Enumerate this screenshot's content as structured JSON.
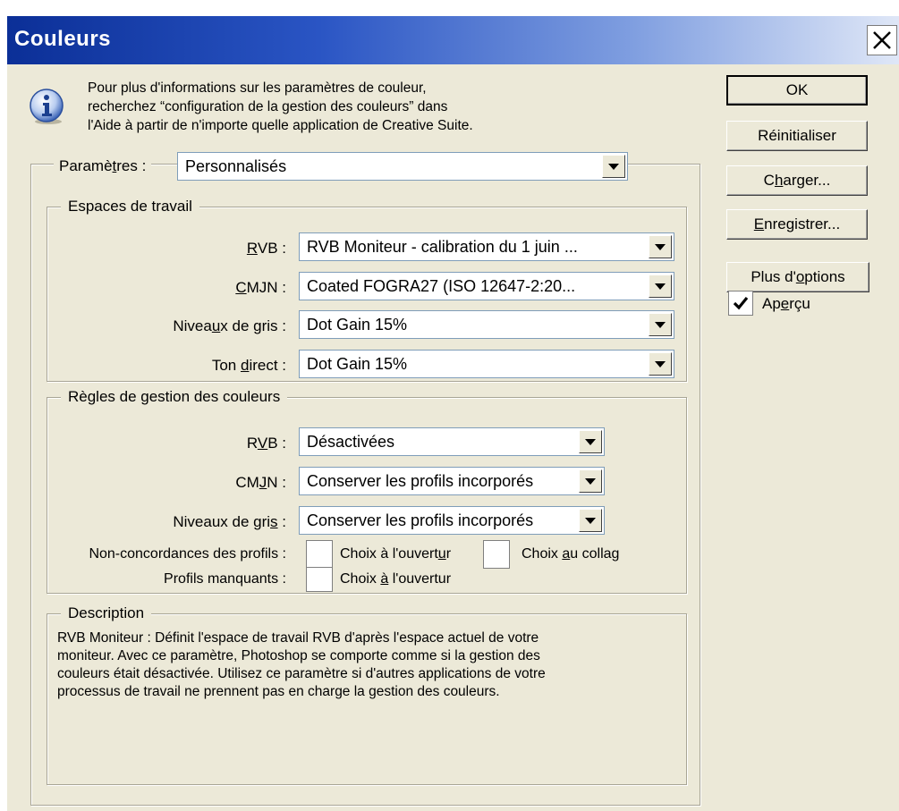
{
  "window": {
    "title": "Couleurs"
  },
  "info": {
    "icon": "info-icon",
    "lines": [
      "Pour plus d'informations sur les paramètres de couleur,",
      "recherchez “configuration de la gestion des couleurs” dans",
      "l'Aide à partir de n'importe quelle application de Creative Suite."
    ]
  },
  "settings": {
    "label": "Paramètres :",
    "value": "Personnalisés"
  },
  "workspaces": {
    "legend": "Espaces de travail",
    "rgb": {
      "label": "RVB :",
      "value": "RVB Moniteur - calibration du 1 juin ..."
    },
    "cmyk": {
      "label": "CMJN :",
      "value": "Coated FOGRA27 (ISO 12647-2:20..."
    },
    "gray": {
      "label": "Niveaux de gris :",
      "value": "Dot Gain 15%"
    },
    "spot": {
      "label": "Ton direct :",
      "value": "Dot Gain 15%"
    }
  },
  "policies": {
    "legend": "Règles de gestion des couleurs",
    "rgb": {
      "label": "RVB :",
      "value": "Désactivées"
    },
    "cmyk": {
      "label": "CMJN :",
      "value": "Conserver les profils incorporés"
    },
    "gray": {
      "label": "Niveaux de gris :",
      "value": "Conserver les profils incorporés"
    },
    "mismatch": {
      "label": "Non-concordances des profils :",
      "open": "Choix à l'ouvertur",
      "paste": "Choix au collag"
    },
    "missing": {
      "label": "Profils manquants :",
      "open": "Choix à l'ouvertur"
    }
  },
  "description": {
    "legend": "Description",
    "lines": [
      "RVB Moniteur : Définit l'espace de travail RVB d'après l'espace actuel de votre",
      "moniteur. Avec ce paramètre, Photoshop se comporte comme si la gestion des",
      "couleurs était désactivée. Utilisez ce paramètre si d'autres applications de votre",
      "processus de travail ne prennent pas en charge la gestion des couleurs."
    ]
  },
  "buttons": {
    "ok": "OK",
    "reset": "Réinitialiser",
    "load": "Charger...",
    "save": "Enregistrer...",
    "more": "Plus d'options"
  },
  "preview": {
    "label": "Aperçu",
    "checked": true
  }
}
